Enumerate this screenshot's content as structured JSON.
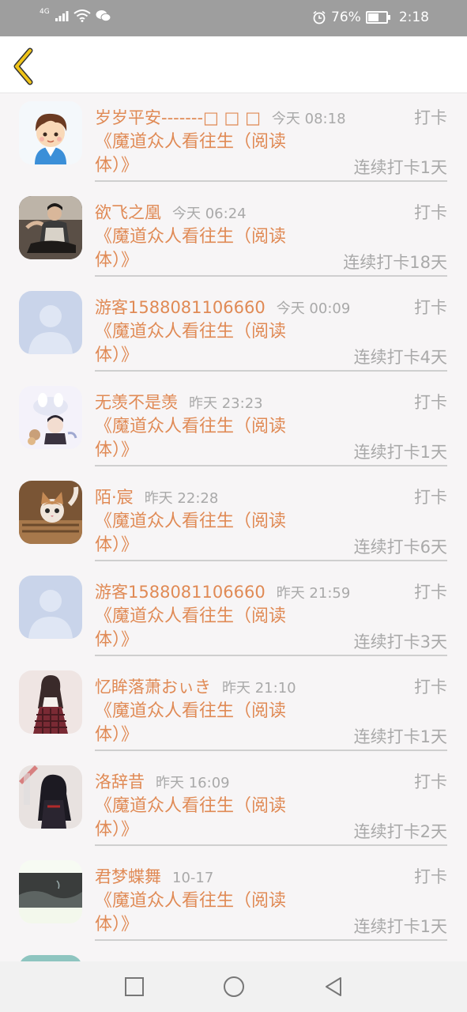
{
  "status_bar": {
    "network_label": "4G",
    "battery": "76%",
    "battery_level": 0.76,
    "time": "2:18"
  },
  "header": {
    "back_icon": "chevron-left-icon"
  },
  "list": [
    {
      "name": "岁岁平安-------□ □ □",
      "time": "今天 08:18",
      "action": "打卡",
      "book": "《魔道众人看往生（阅读体）》",
      "streak": "连续打卡1天",
      "avatar": "cartoon-boy"
    },
    {
      "name": "欲飞之凰",
      "time": "今天 06:24",
      "action": "打卡",
      "book": "《魔道众人看往生（阅读体）》",
      "streak": "连续打卡18天",
      "avatar": "photo-person-sitting"
    },
    {
      "name": "游客1588081106660",
      "time": "今天 00:09",
      "action": "打卡",
      "book": "《魔道众人看往生（阅读体）》",
      "streak": "连续打卡4天",
      "avatar": "default-user"
    },
    {
      "name": "无羡不是羡",
      "time": "昨天 23:23",
      "action": "打卡",
      "book": "《魔道众人看往生（阅读体）》",
      "streak": "连续打卡1天",
      "avatar": "anime-illustration"
    },
    {
      "name": "陌·宸",
      "time": "昨天 22:28",
      "action": "打卡",
      "book": "《魔道众人看往生（阅读体）》",
      "streak": "连续打卡6天",
      "avatar": "cat-photo"
    },
    {
      "name": "游客1588081106660",
      "time": "昨天 21:59",
      "action": "打卡",
      "book": "《魔道众人看往生（阅读体）》",
      "streak": "连续打卡3天",
      "avatar": "default-user"
    },
    {
      "name": "忆眸落萧おぃき",
      "time": "昨天 21:10",
      "action": "打卡",
      "book": "《魔道众人看往生（阅读体）》",
      "streak": "连续打卡1天",
      "avatar": "girl-dress"
    },
    {
      "name": "洛辞昔",
      "time": "昨天 16:09",
      "action": "打卡",
      "book": "《魔道众人看往生（阅读体）》",
      "streak": "连续打卡2天",
      "avatar": "anime-dark"
    },
    {
      "name": "君梦蝶舞",
      "time": "10-17",
      "action": "打卡",
      "book": "《魔道众人看往生（阅读体）》",
      "streak": "连续打卡1天",
      "avatar": "dark-scene"
    }
  ],
  "nav": {
    "recent_icon": "square-icon",
    "home_icon": "circle-icon",
    "back_icon": "triangle-back-icon"
  },
  "colors": {
    "accent": "#e08a55",
    "muted": "#a9a9a9",
    "back_chevron": "#f0c419",
    "status_bar": "#9e9e9e"
  }
}
